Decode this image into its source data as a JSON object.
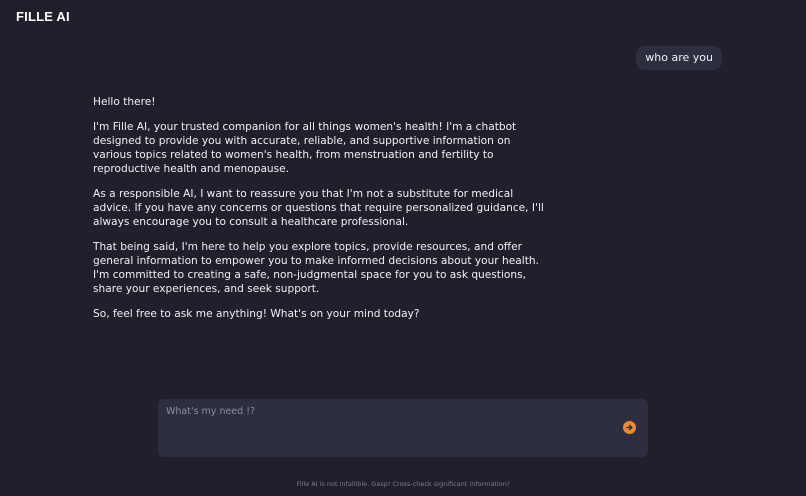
{
  "app": {
    "brand": "FILLE AI"
  },
  "conversation": {
    "user_message": "who are you",
    "assistant_paragraphs": [
      "Hello there!",
      "I'm Fille AI, your trusted companion for all things women's health! I'm a chatbot designed to provide you with accurate, reliable, and supportive information on various topics related to women's health, from menstruation and fertility to reproductive health and menopause.",
      "As a responsible AI, I want to reassure you that I'm not a substitute for medical advice. If you have any concerns or questions that require personalized guidance, I'll always encourage you to consult a healthcare professional.",
      "That being said, I'm here to help you explore topics, provide resources, and offer general information to empower you to make informed decisions about your health. I'm committed to creating a safe, non-judgmental space for you to ask questions, share your experiences, and seek support.",
      "So, feel free to ask me anything! What's on your mind today?"
    ]
  },
  "composer": {
    "placeholder": "What's my need !?",
    "value": "",
    "send_icon": "arrow-right-circle-icon"
  },
  "footer": {
    "disclaimer": "Fille AI is not infallible. Gasp! Cross-check significant information!"
  },
  "colors": {
    "background": "#201f2b",
    "surface": "#2d2e40",
    "accent": "#f08a30",
    "text": "#f1f0f5",
    "muted": "#7e7d8c"
  }
}
